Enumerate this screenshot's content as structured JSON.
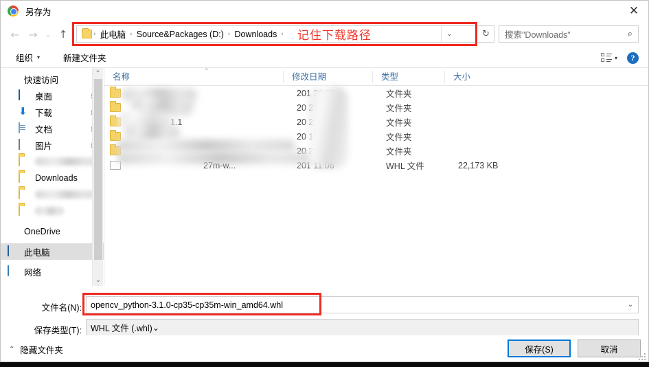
{
  "window": {
    "title": "另存为",
    "icon": "chrome-logo-icon",
    "close_label": "✕"
  },
  "nav": {
    "back": "←",
    "forward": "→",
    "recent": "⌄",
    "up": "↑",
    "dropdown": "⌄",
    "refresh": "↻"
  },
  "address": {
    "crumbs": [
      "此电脑",
      "Source&Packages (D:)",
      "Downloads"
    ],
    "separator": "›"
  },
  "annotation": {
    "address_note": "记住下载路径"
  },
  "search": {
    "placeholder": "搜索\"Downloads\"",
    "icon": "search-icon"
  },
  "command_bar": {
    "organize": "组织",
    "organize_caret": "▾",
    "new_folder": "新建文件夹",
    "view_caret": "▾",
    "help": "?"
  },
  "sidebar": {
    "items": [
      {
        "label": "快速访问",
        "icon": "star-icon",
        "indent": false,
        "selected": false,
        "pinned": false,
        "blurred": false
      },
      {
        "label": "桌面",
        "icon": "desktop-icon",
        "indent": true,
        "selected": false,
        "pinned": true,
        "blurred": false
      },
      {
        "label": "下载",
        "icon": "download-icon",
        "indent": true,
        "selected": false,
        "pinned": true,
        "blurred": false
      },
      {
        "label": "文档",
        "icon": "document-icon",
        "indent": true,
        "selected": false,
        "pinned": true,
        "blurred": false
      },
      {
        "label": "图片",
        "icon": "picture-icon",
        "indent": true,
        "selected": false,
        "pinned": true,
        "blurred": false
      },
      {
        "label": "",
        "icon": "folder-icon",
        "indent": true,
        "selected": false,
        "pinned": false,
        "blurred": true
      },
      {
        "label": "Downloads",
        "icon": "folder-icon",
        "indent": true,
        "selected": false,
        "pinned": false,
        "blurred": false
      },
      {
        "label": "",
        "icon": "folder-icon",
        "indent": true,
        "selected": false,
        "pinned": false,
        "blurred": true
      },
      {
        "label": "",
        "icon": "folder-icon",
        "indent": true,
        "selected": false,
        "pinned": false,
        "blurred": true
      },
      {
        "label": "OneDrive",
        "icon": "onedrive-icon",
        "indent": false,
        "selected": false,
        "pinned": false,
        "blurred": false
      },
      {
        "label": "此电脑",
        "icon": "this-pc-icon",
        "indent": false,
        "selected": true,
        "pinned": false,
        "blurred": false
      },
      {
        "label": "网络",
        "icon": "network-icon",
        "indent": false,
        "selected": false,
        "pinned": false,
        "blurred": false
      }
    ],
    "scroll_up": "⌃",
    "scroll_down": "⌄"
  },
  "file_list": {
    "columns": [
      "名称",
      "修改日期",
      "类型",
      "大小"
    ],
    "sort_mark": "⌃",
    "rows": [
      {
        "name": "",
        "date": "201          20:33",
        "type": "文件夹",
        "size": "",
        "is_folder": true,
        "blurred": true
      },
      {
        "name": "",
        "date": "20           21:17",
        "type": "文件夹",
        "size": "",
        "is_folder": true,
        "blurred": true
      },
      {
        "name": "1.1",
        "date": "20           2:10",
        "type": "文件夹",
        "size": "",
        "is_folder": true,
        "blurred": true
      },
      {
        "name": "",
        "date": "20           15:37",
        "type": "文件夹",
        "size": "",
        "is_folder": true,
        "blurred": true
      },
      {
        "name": "",
        "date": "20           22:51",
        "type": "文件夹",
        "size": "",
        "is_folder": true,
        "blurred": true
      },
      {
        "name": "27m-w...",
        "date": "201          11:06",
        "type": "WHL 文件",
        "size": "22,173 KB",
        "is_folder": false,
        "blurred": true
      }
    ]
  },
  "form": {
    "filename_label": "文件名(N):",
    "filename_value": "opencv_python-3.1.0-cp35-cp35m-win_amd64.whl",
    "filename_dropdown": "⌄",
    "filetype_label": "保存类型(T):",
    "filetype_value": "WHL 文件 (.whl)"
  },
  "footer": {
    "hide_folders": "隐藏文件夹",
    "hide_folders_chevron": "⌃",
    "save": "保存(S)",
    "cancel": "取消"
  },
  "colors": {
    "annotation_red": "#ee2a22",
    "focus_blue": "#0078d7",
    "header_blue": "#3b6ea5",
    "selection_gray": "#dedede"
  }
}
